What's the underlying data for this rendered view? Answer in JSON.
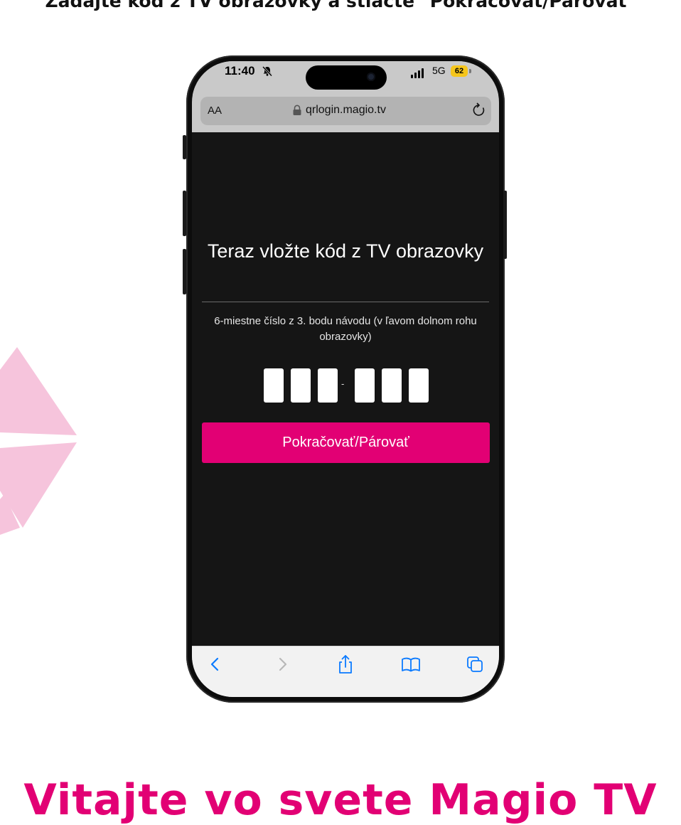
{
  "caption_top": "Zadajte kód z TV obrazovky a stlačte \"Pokračovať/Párovať\"",
  "caption_bottom": "Vitajte vo svete Magio TV",
  "status_bar": {
    "time": "11:40",
    "network": "5G",
    "battery": "62"
  },
  "browser": {
    "text_size": "AA",
    "url": "qrlogin.magio.tv"
  },
  "page": {
    "heading": "Teraz vložte kód z TV obrazovky",
    "instruction": "6-miestne číslo z 3. bodu návodu (v ľavom dolnom rohu obrazovky)",
    "code_values": [
      "",
      "",
      "",
      "",
      "",
      ""
    ],
    "separator": "-",
    "continue_label": "Pokračovať/Párovať"
  },
  "colors": {
    "brand": "#e20074",
    "page_background": "#151515",
    "decor_pink": "#f6c4dc"
  },
  "icons": {
    "muted": "bell-slash-icon",
    "lock": "lock-icon",
    "reload": "reload-icon",
    "back": "chevron-left-icon",
    "forward": "chevron-right-icon",
    "share": "share-icon",
    "bookmarks": "book-icon",
    "tabs": "tabs-icon"
  }
}
